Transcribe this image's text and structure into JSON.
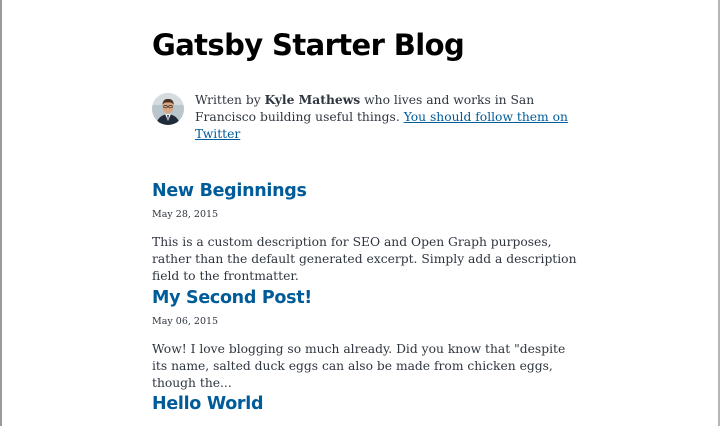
{
  "site": {
    "title": "Gatsby Starter Blog"
  },
  "bio": {
    "prefix": "Written by ",
    "author": "Kyle Mathews",
    "middle": " who lives and works in San Francisco building useful things. ",
    "link_text": "You should follow them on Twitter"
  },
  "posts": [
    {
      "title": "New Beginnings",
      "date": "May 28, 2015",
      "excerpt": "This is a custom description for SEO and Open Graph purposes, rather than the default generated excerpt. Simply add a description field to the frontmatter."
    },
    {
      "title": "My Second Post!",
      "date": "May 06, 2015",
      "excerpt": "Wow! I love blogging so much already. Did you know that \"despite its name, salted duck eggs can also be made from chicken eggs, though the..."
    },
    {
      "title": "Hello World",
      "date": "",
      "excerpt": ""
    }
  ],
  "colors": {
    "link": "#005b99",
    "text": "#2e353f",
    "heading": "#000000"
  },
  "icons": {
    "avatar": "author-avatar-photo"
  }
}
